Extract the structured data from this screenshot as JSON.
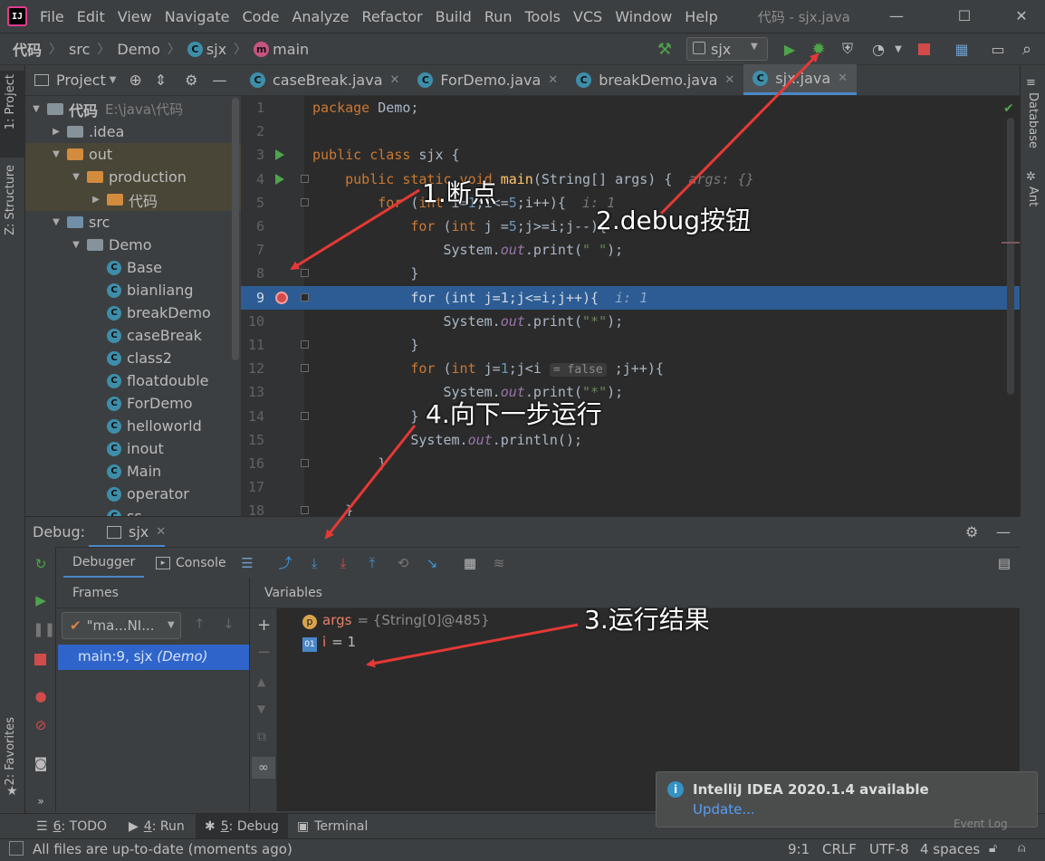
{
  "menubar": {
    "items": [
      {
        "label": "File",
        "u": "F"
      },
      {
        "label": "Edit",
        "u": "E"
      },
      {
        "label": "View",
        "u": "V"
      },
      {
        "label": "Navigate",
        "u": "N"
      },
      {
        "label": "Code",
        "u": "C"
      },
      {
        "label": "Analyze",
        "u": "z"
      },
      {
        "label": "Refactor",
        "u": "R"
      },
      {
        "label": "Build",
        "u": "B"
      },
      {
        "label": "Run",
        "u": "u"
      },
      {
        "label": "Tools",
        "u": "T"
      },
      {
        "label": "VCS",
        "u": "S"
      },
      {
        "label": "Window",
        "u": "W"
      },
      {
        "label": "Help",
        "u": "H"
      }
    ],
    "window_title": "代码 - sjx.java",
    "logo_text": "IJ"
  },
  "breadcrumb": {
    "items": [
      "代码",
      "src",
      "Demo",
      "sjx",
      "main"
    ]
  },
  "run_config": {
    "label": "sjx"
  },
  "left_strip": {
    "project_tab": "1: Project",
    "structure_tab": "Z: Structure",
    "favorites_tab": "2: Favorites"
  },
  "right_strip": {
    "database_tab": "Database",
    "ant_tab": "Ant"
  },
  "project": {
    "title": "Project",
    "tree": [
      {
        "label": "代码",
        "extra": "E:\\java\\代码",
        "indent": 0,
        "arrow": "▼",
        "kind": "folder-blue",
        "bold": true
      },
      {
        "label": ".idea",
        "indent": 1,
        "arrow": "▶",
        "kind": "folder-blue"
      },
      {
        "label": "out",
        "indent": 1,
        "arrow": "▼",
        "kind": "folder-orange",
        "hl": true
      },
      {
        "label": "production",
        "indent": 2,
        "arrow": "▼",
        "kind": "folder-orange",
        "hl": true
      },
      {
        "label": "代码",
        "indent": 3,
        "arrow": "▶",
        "kind": "folder-orange",
        "hl": true
      },
      {
        "label": "src",
        "indent": 1,
        "arrow": "▼",
        "kind": "folder-src"
      },
      {
        "label": "Demo",
        "indent": 2,
        "arrow": "▼",
        "kind": "folder-blue"
      },
      {
        "label": "Base",
        "indent": 3,
        "kind": "class"
      },
      {
        "label": "bianliang",
        "indent": 3,
        "kind": "class"
      },
      {
        "label": "breakDemo",
        "indent": 3,
        "kind": "class"
      },
      {
        "label": "caseBreak",
        "indent": 3,
        "kind": "class"
      },
      {
        "label": "class2",
        "indent": 3,
        "kind": "class"
      },
      {
        "label": "floatdouble",
        "indent": 3,
        "kind": "class"
      },
      {
        "label": "ForDemo",
        "indent": 3,
        "kind": "class"
      },
      {
        "label": "helloworld",
        "indent": 3,
        "kind": "class"
      },
      {
        "label": "inout",
        "indent": 3,
        "kind": "class"
      },
      {
        "label": "Main",
        "indent": 3,
        "kind": "class"
      },
      {
        "label": "operator",
        "indent": 3,
        "kind": "class"
      },
      {
        "label": "ss",
        "indent": 3,
        "kind": "class"
      }
    ]
  },
  "editor_tabs": [
    {
      "label": "caseBreak.java",
      "active": false
    },
    {
      "label": "ForDemo.java",
      "active": false
    },
    {
      "label": "breakDemo.java",
      "active": false
    },
    {
      "label": "sjx.java",
      "active": true
    }
  ],
  "editor": {
    "lines": [
      {
        "n": "1",
        "html": "<span class=\"kw\">package</span> Demo;"
      },
      {
        "n": "2",
        "html": ""
      },
      {
        "n": "3",
        "html": "<span class=\"kw\">public class</span> sjx {",
        "run": true
      },
      {
        "n": "4",
        "html": "    <span class=\"kw\">public static void</span> <span class=\"fn\">main</span>(String[] args) {  <span class=\"hint\">args: {}</span>",
        "run": true
      },
      {
        "n": "5",
        "html": "        <span class=\"kw\">for</span> (<span class=\"kw\">int</span> i=<span class=\"num\">1</span>;i&lt;=<span class=\"num\">5</span>;i++){  <span class=\"hint\">i: 1</span>"
      },
      {
        "n": "6",
        "html": "            <span class=\"kw\">for</span> (<span class=\"kw\">int</span> j =<span class=\"num\">5</span>;j&gt;=i;j--){"
      },
      {
        "n": "7",
        "html": "                System.<span class=\"fld\">out</span>.print(<span class=\"str\">\" \"</span>);"
      },
      {
        "n": "8",
        "html": "            }"
      },
      {
        "n": "9",
        "html": "            <span class=\"kw\">for</span> (<span class=\"kw\">int</span> j=<span class=\"num\">1</span>;j&lt;=i;j++){  <span class=\"hint\">i: 1</span>",
        "hl": true,
        "bp": true
      },
      {
        "n": "10",
        "html": "                System.<span class=\"fld\">out</span>.print(<span class=\"str\">\"*\"</span>);"
      },
      {
        "n": "11",
        "html": "            }"
      },
      {
        "n": "12",
        "html": "            <span class=\"kw\">for</span> (<span class=\"kw\">int</span> j=<span class=\"num\">1</span>;j&lt;i <span class=\"inlay\">= false</span> ;j++){"
      },
      {
        "n": "13",
        "html": "                System.<span class=\"fld\">out</span>.print(<span class=\"str\">\"*\"</span>);"
      },
      {
        "n": "14",
        "html": "            }"
      },
      {
        "n": "15",
        "html": "            System.<span class=\"fld\">out</span>.println();"
      },
      {
        "n": "16",
        "html": "        }"
      },
      {
        "n": "17",
        "html": ""
      },
      {
        "n": "18",
        "html": "    }"
      }
    ]
  },
  "debug": {
    "label": "Debug:",
    "session": "sjx",
    "tab_debugger": "Debugger",
    "tab_console": "Console",
    "frames_title": "Frames",
    "thread_select": "\"ma...NI...",
    "frame_item_text": "main:9, sjx",
    "frame_item_class": "(Demo)",
    "variables_title": "Variables",
    "vars": [
      {
        "badge": "p",
        "name": "args",
        "value": "= {String[0]@485}"
      },
      {
        "badge": "01",
        "name": "i",
        "value": "= 1"
      }
    ]
  },
  "bottom_tabs": [
    {
      "num": "6",
      "label": ": TODO",
      "icon": "☰"
    },
    {
      "num": "4",
      "label": ": Run",
      "icon": "▶"
    },
    {
      "num": "5",
      "label": ": Debug",
      "icon": "✱",
      "active": true
    },
    {
      "num": "",
      "label": "Terminal",
      "icon": "▣"
    }
  ],
  "status": {
    "message": "All files are up-to-date (moments ago)",
    "position": "9:1",
    "line_sep": "CRLF",
    "encoding": "UTF-8",
    "indent": "4 spaces",
    "event_log": "Event Log"
  },
  "notification": {
    "title": "IntelliJ IDEA 2020.1.4 available",
    "link": "Update..."
  },
  "annotations": {
    "a1": "1.断点",
    "a2": "2.debug按钮",
    "a3": "3.运行结果",
    "a4": "4.向下一步运行"
  },
  "colors": {
    "accent": "#4a88c7",
    "highlight_line": "#2d5c94",
    "arrow": "#e53935"
  }
}
